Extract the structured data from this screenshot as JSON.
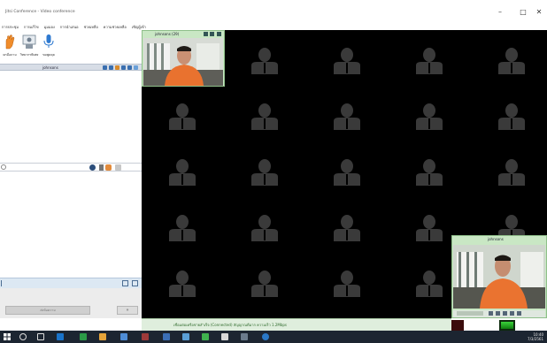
{
  "window": {
    "title": "Jitsi Conference - Video conference",
    "minimize_glyph": "–",
    "maximize_glyph": "□",
    "close_glyph": "✕"
  },
  "menubar": {
    "items": [
      "การประชุม",
      "การแก้ไข",
      "มุมมอง",
      "การนำเสนอ",
      "ช่วยเหลือ",
      "ความช่วยเหลือ",
      "เชิญผู้เข้า"
    ]
  },
  "toolbar": {
    "buttons": [
      {
        "label": "ยกมือถาม",
        "icon": "raise-hand-icon",
        "color": "#f08c2a"
      },
      {
        "label": "วิทยากรพิเศษ",
        "icon": "presenter-icon",
        "color": "#6f7f8f"
      },
      {
        "label": "ขอพูดคุย",
        "icon": "microphone-icon",
        "color": "#2f7ad0"
      }
    ]
  },
  "participants_panel": {
    "header_label": "johnsons"
  },
  "chat": {
    "input_placeholder": ""
  },
  "panel_bottom": {
    "send_label": "ส่งข้อความ",
    "more_label": "»"
  },
  "videos": [
    {
      "id": "remote",
      "title": "johnsons (29)"
    },
    {
      "id": "local",
      "title": "johnsons"
    }
  ],
  "status_bar": {
    "text": "เชื่อมต่อเครือข่ายสำเร็จ (Connected) สัญญาณดีมาก ความเร็ว 1.2Mbps"
  },
  "taskbar": {
    "time": "10:40",
    "date": "7/3/2561"
  },
  "colors": {
    "video_bg": "#000000",
    "placeholder": "#3a3a3a",
    "window_chrome_green": "#c9e7c4",
    "taskbar": "#1c2531"
  }
}
